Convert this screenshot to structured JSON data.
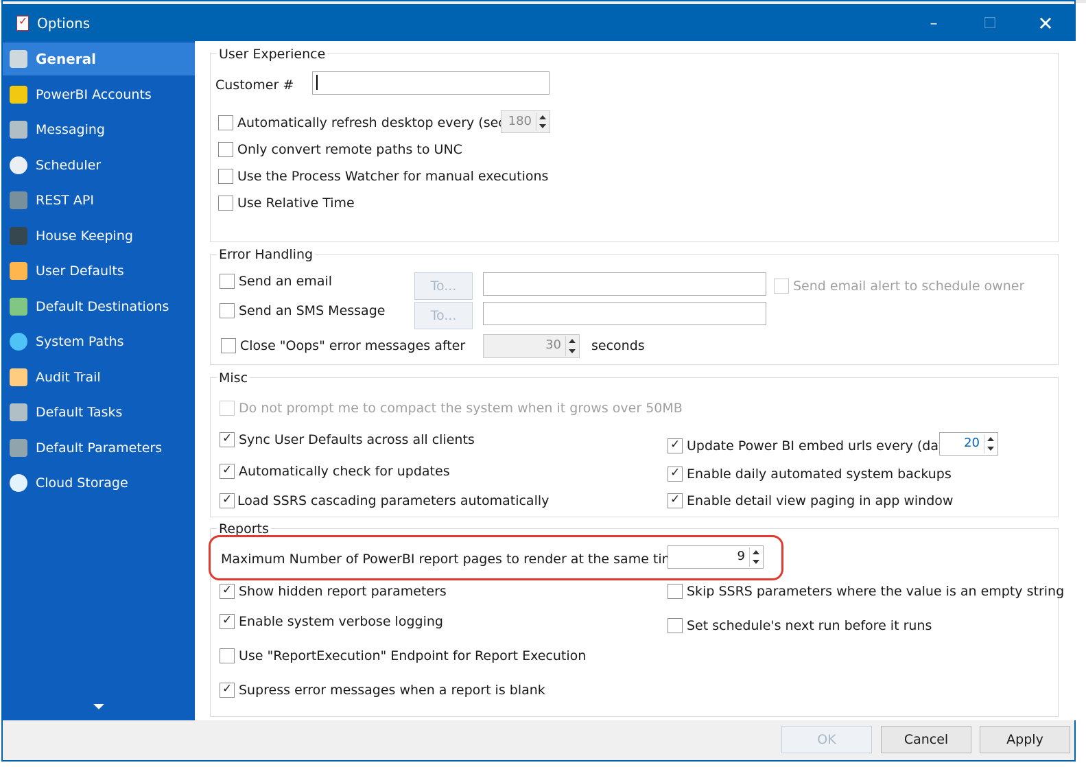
{
  "window": {
    "title": "Options",
    "minimize": "–",
    "maximize": "☐",
    "close": "✕"
  },
  "sidebar": {
    "items": [
      {
        "label": "General",
        "icon": "general-icon"
      },
      {
        "label": "PowerBI Accounts",
        "icon": "powerbi-accounts-icon"
      },
      {
        "label": "Messaging",
        "icon": "messaging-icon"
      },
      {
        "label": "Scheduler",
        "icon": "clock-icon"
      },
      {
        "label": "REST API",
        "icon": "rest-api-icon"
      },
      {
        "label": "House Keeping",
        "icon": "housekeeping-icon"
      },
      {
        "label": "User Defaults",
        "icon": "users-icon"
      },
      {
        "label": "Default Destinations",
        "icon": "destinations-icon"
      },
      {
        "label": "System Paths",
        "icon": "globe-icon"
      },
      {
        "label": "Audit Trail",
        "icon": "audit-icon"
      },
      {
        "label": "Default Tasks",
        "icon": "tasks-icon"
      },
      {
        "label": "Default Parameters",
        "icon": "parameters-icon"
      },
      {
        "label": "Cloud Storage",
        "icon": "cloud-icon"
      }
    ],
    "active_index": 0
  },
  "user_experience": {
    "title": "User Experience",
    "customer_label": "Customer #",
    "customer_value": "",
    "auto_refresh_label": "Automatically refresh desktop every (secs)",
    "auto_refresh_checked": false,
    "auto_refresh_value": "180",
    "unc_label": "Only convert remote paths to UNC",
    "unc_checked": false,
    "process_watcher_label": "Use the Process Watcher for manual executions",
    "process_watcher_checked": false,
    "relative_time_label": "Use Relative Time",
    "relative_time_checked": false
  },
  "error_handling": {
    "title": "Error Handling",
    "send_email_label": "Send an email",
    "send_email_checked": false,
    "email_to_button": "To...",
    "email_to_value": "",
    "schedule_owner_label": "Send email alert to schedule owner",
    "schedule_owner_checked": false,
    "send_sms_label": "Send an SMS Message",
    "send_sms_checked": false,
    "sms_to_button": "To...",
    "sms_to_value": "",
    "close_oops_label": "Close \"Oops\" error messages after",
    "close_oops_checked": false,
    "close_oops_value": "30",
    "seconds_label": "seconds"
  },
  "misc": {
    "title": "Misc",
    "compact_label": "Do not prompt me to compact the system when it grows over 50MB",
    "compact_checked": false,
    "sync_label": "Sync User Defaults across all clients",
    "sync_checked": true,
    "auto_update_label": "Automatically check for updates",
    "auto_update_checked": true,
    "ssrs_cascading_label": "Load SSRS cascading parameters automatically",
    "ssrs_cascading_checked": true,
    "embed_urls_label": "Update Power BI embed urls every (days)",
    "embed_urls_checked": true,
    "embed_urls_value": "20",
    "daily_backups_label": "Enable daily automated system backups",
    "daily_backups_checked": true,
    "detail_paging_label": "Enable detail view paging in app window",
    "detail_paging_checked": true
  },
  "reports": {
    "title": "Reports",
    "max_pages_label": "Maximum Number  of PowerBI report pages to render at the same time",
    "max_pages_value": "9",
    "hidden_params_label": "Show hidden report parameters",
    "hidden_params_checked": true,
    "verbose_logging_label": "Enable system verbose logging",
    "verbose_logging_checked": true,
    "report_execution_label": "Use \"ReportExecution\" Endpoint for Report Execution",
    "report_execution_checked": false,
    "suppress_errors_label": "Supress error messages when a report is blank",
    "suppress_errors_checked": true,
    "skip_ssrs_label": "Skip SSRS parameters where the value is an empty string",
    "skip_ssrs_checked": false,
    "next_run_label": "Set schedule's next run before it runs",
    "next_run_checked": false
  },
  "footer": {
    "ok": "OK",
    "cancel": "Cancel",
    "apply": "Apply"
  },
  "colors": {
    "titlebar": "#0063b1",
    "sidebar": "#0e5fbd",
    "sidebar_active": "#2f7fd8",
    "highlight": "#e03a2e"
  }
}
